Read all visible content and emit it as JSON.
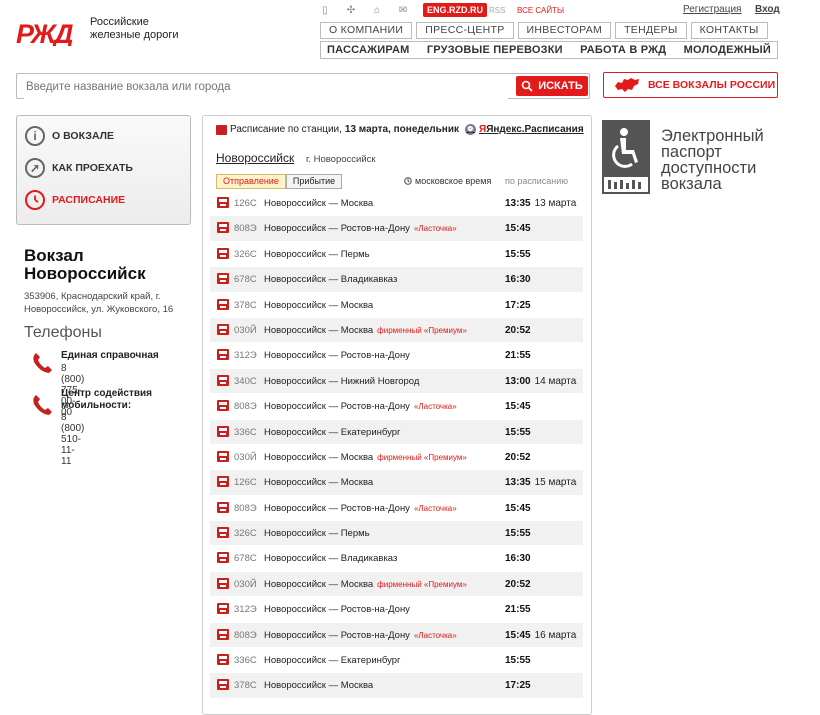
{
  "brand": {
    "logo_text": "РЖД",
    "line1": "Российские",
    "line2": "железные дороги"
  },
  "topbar": {
    "eng_label": "ENG.RZD.RU",
    "rss_label": "RSS",
    "all_sites_label": "ВСЕ САЙТЫ",
    "register_label": "Регистрация",
    "login_label": "Вход"
  },
  "nav_primary": [
    "О КОМПАНИИ",
    "ПРЕСС-ЦЕНТР",
    "ИНВЕСТОРАМ",
    "ТЕНДЕРЫ",
    "КОНТАКТЫ"
  ],
  "nav_secondary": [
    "ПАССАЖИРАМ",
    "ГРУЗОВЫЕ ПЕРЕВОЗКИ",
    "РАБОТА В РЖД",
    "МОЛОДЕЖНЫЙ"
  ],
  "search": {
    "placeholder": "Введите название вокзала или города",
    "button_label": "ИСКАТЬ"
  },
  "all_stations_label": "ВСЕ ВОКЗАЛЫ РОССИИ",
  "side_menu": [
    {
      "label": "О ВОКЗАЛЕ",
      "icon": "info-icon",
      "active": false
    },
    {
      "label": "КАК ПРОЕХАТЬ",
      "icon": "compass-icon",
      "active": false
    },
    {
      "label": "РАСПИСАНИЕ",
      "icon": "clock-icon",
      "active": true
    }
  ],
  "station": {
    "title_line1": "Вокзал",
    "title_line2": "Новороссийск",
    "address_line1": "353906, Краснодарский край, г.",
    "address_line2": "Новороссийск, ул. Жуковского, 16"
  },
  "phones": {
    "heading": "Телефоны",
    "items": [
      {
        "name": "Единая справочная",
        "number": "8 (800) 775-00-00"
      },
      {
        "name": "Центр содействия мобильности:",
        "number": "8 (800) 510-11-11"
      }
    ]
  },
  "schedule": {
    "header_prefix": "Расписание по станции,",
    "header_date": "13 марта, понедельник",
    "yandex_label": "Яндекс.Расписания",
    "yandex_y": "Я",
    "station_link": "Новороссийск",
    "station_city": "г. Новороссийск",
    "tab_departure": "Отправление",
    "tab_arrival": "Прибытие",
    "time_mode": "московское время",
    "by_plan": "по расписанию",
    "rows": [
      {
        "num": "126С",
        "route": "Новороссийск — Москва",
        "note": "",
        "time": "13:35",
        "date": "13 марта"
      },
      {
        "num": "808Э",
        "route": "Новороссийск — Ростов-на-Дону",
        "note": "«Ласточка»",
        "time": "15:45",
        "date": ""
      },
      {
        "num": "326С",
        "route": "Новороссийск — Пермь",
        "note": "",
        "time": "15:55",
        "date": ""
      },
      {
        "num": "678С",
        "route": "Новороссийск — Владикавказ",
        "note": "",
        "time": "16:30",
        "date": ""
      },
      {
        "num": "378С",
        "route": "Новороссийск — Москва",
        "note": "",
        "time": "17:25",
        "date": ""
      },
      {
        "num": "030Й",
        "route": "Новороссийск — Москва",
        "note": "фирменный «Премиум»",
        "time": "20:52",
        "date": ""
      },
      {
        "num": "312Э",
        "route": "Новороссийск — Ростов-на-Дону",
        "note": "",
        "time": "21:55",
        "date": ""
      },
      {
        "num": "340С",
        "route": "Новороссийск — Нижний Новгород",
        "note": "",
        "time": "13:00",
        "date": "14 марта"
      },
      {
        "num": "808Э",
        "route": "Новороссийск — Ростов-на-Дону",
        "note": "«Ласточка»",
        "time": "15:45",
        "date": ""
      },
      {
        "num": "336С",
        "route": "Новороссийск — Екатеринбург",
        "note": "",
        "time": "15:55",
        "date": ""
      },
      {
        "num": "030Й",
        "route": "Новороссийск — Москва",
        "note": "фирменный «Премиум»",
        "time": "20:52",
        "date": ""
      },
      {
        "num": "126С",
        "route": "Новороссийск — Москва",
        "note": "",
        "time": "13:35",
        "date": "15 марта"
      },
      {
        "num": "808Э",
        "route": "Новороссийск — Ростов-на-Дону",
        "note": "«Ласточка»",
        "time": "15:45",
        "date": ""
      },
      {
        "num": "326С",
        "route": "Новороссийск — Пермь",
        "note": "",
        "time": "15:55",
        "date": ""
      },
      {
        "num": "678С",
        "route": "Новороссийск — Владикавказ",
        "note": "",
        "time": "16:30",
        "date": ""
      },
      {
        "num": "030Й",
        "route": "Новороссийск — Москва",
        "note": "фирменный «Премиум»",
        "time": "20:52",
        "date": ""
      },
      {
        "num": "312Э",
        "route": "Новороссийск — Ростов-на-Дону",
        "note": "",
        "time": "21:55",
        "date": ""
      },
      {
        "num": "808Э",
        "route": "Новороссийск — Ростов-на-Дону",
        "note": "«Ласточка»",
        "time": "15:45",
        "date": "16 марта"
      },
      {
        "num": "336С",
        "route": "Новороссийск — Екатеринбург",
        "note": "",
        "time": "15:55",
        "date": ""
      },
      {
        "num": "378С",
        "route": "Новороссийск — Москва",
        "note": "",
        "time": "17:25",
        "date": ""
      }
    ]
  },
  "accessibility": {
    "line1": "Электронный",
    "line2": "паспорт",
    "line3": "доступности",
    "line4": "вокзала"
  },
  "colors": {
    "brand_red": "#e21a1a",
    "row_alt": "#f1f1f1"
  }
}
